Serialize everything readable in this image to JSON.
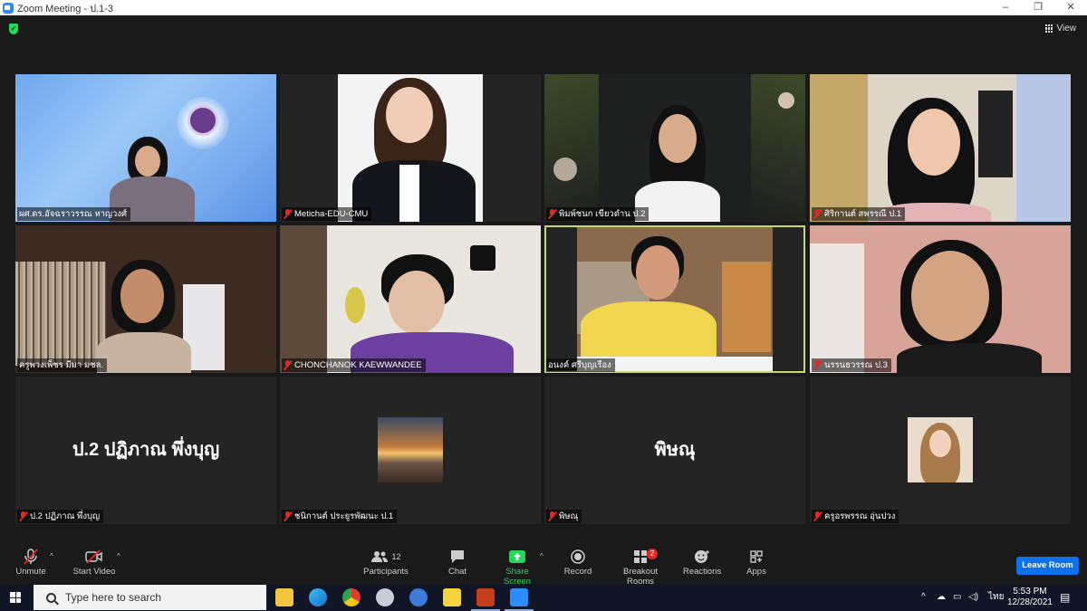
{
  "window": {
    "title": "Zoom Meeting - ป.1-3",
    "minimize": "–",
    "restore": "❐",
    "close": "✕"
  },
  "header": {
    "view_label": "View"
  },
  "tiles": [
    {
      "name": "ผศ.ดร.อัจฉราวรรณ หาญวงศ์",
      "muted": false
    },
    {
      "name": "Meticha-EDU-CMU",
      "muted": true
    },
    {
      "name": "พิมพ์ชนก เขียวดำน ป.2",
      "muted": true
    },
    {
      "name": "ศิริกานต์ สพรรณี ป.1",
      "muted": true
    },
    {
      "name": "ครูพวงเพ็ชร มีมา มชล.",
      "muted": false
    },
    {
      "name": "CHONCHANOK KAEWWANDEE",
      "muted": true
    },
    {
      "name": "อนงค์ ศรีบุญเรือง",
      "muted": false
    },
    {
      "name": "นรรนธวรรณ ป.3",
      "muted": true
    },
    {
      "name": "ป.2 ปฏิภาณ พึ่งบุญ",
      "big": "ป.2 ปฏิภาณ พึ่งบุญ",
      "muted": true
    },
    {
      "name": "ชนิกานต์ ประยูรพัฒนะ ป.1",
      "muted": true
    },
    {
      "name": "พิษณุ",
      "big": "พิษณุ",
      "muted": true
    },
    {
      "name": "ครูอรพรรณ อุ่นปวง",
      "muted": true
    }
  ],
  "toolbar": {
    "unmute": "Unmute",
    "start_video": "Start Video",
    "participants": "Participants",
    "participants_count": "12",
    "chat": "Chat",
    "share_screen": "Share Screen",
    "record": "Record",
    "breakout_rooms": "Breakout Rooms",
    "breakout_badge": "2",
    "reactions": "Reactions",
    "apps": "Apps",
    "leave": "Leave Room",
    "caret": "^"
  },
  "taskbar": {
    "search_placeholder": "Type here to search",
    "language": "ไทย",
    "time": "5:53 PM",
    "date": "12/28/2021",
    "tray_caret": "^"
  },
  "colors": {
    "active_border": "#c6d76b",
    "leave_button": "#0e71eb",
    "share_green": "#23d959",
    "taskbar": "#101626"
  }
}
